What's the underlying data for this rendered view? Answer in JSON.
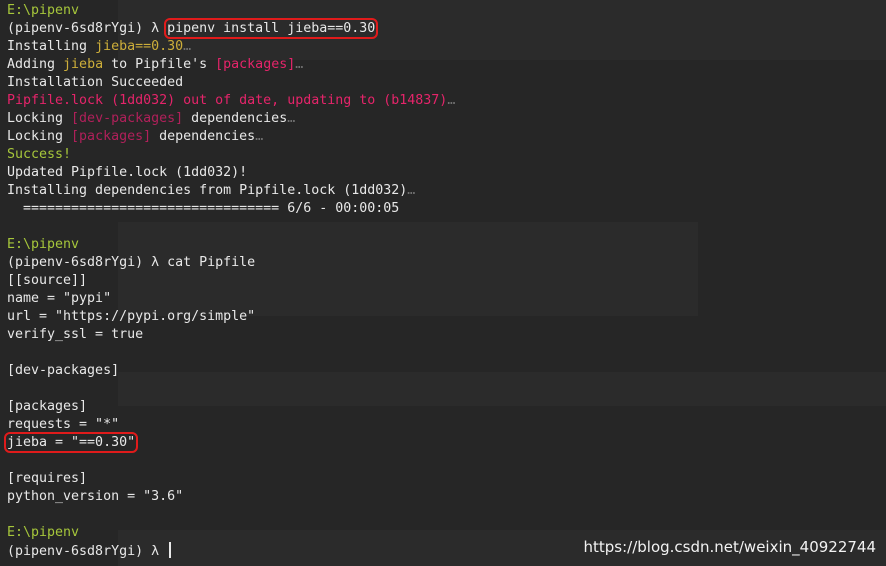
{
  "lines": [
    {
      "segments": [
        {
          "text": "E:\\pipenv",
          "cls": "green"
        }
      ]
    },
    {
      "segments": [
        {
          "text": "(pipenv-6sd8rYgi) λ "
        },
        {
          "text": "pipenv install jieba==0.30",
          "cls": "boxed"
        }
      ]
    },
    {
      "segments": [
        {
          "text": "Installing "
        },
        {
          "text": "jieba==0.30",
          "cls": "yellow"
        },
        {
          "text": "…",
          "cls": "dim"
        }
      ]
    },
    {
      "segments": [
        {
          "text": "Adding "
        },
        {
          "text": "jieba",
          "cls": "yellow"
        },
        {
          "text": " to Pipfile's "
        },
        {
          "text": "[packages]",
          "cls": "magenta"
        },
        {
          "text": "…",
          "cls": "dim"
        }
      ]
    },
    {
      "segments": [
        {
          "text": "Installation Succeeded"
        }
      ]
    },
    {
      "segments": [
        {
          "text": "Pipfile.lock (1dd032) out of date, updating to (b14837)",
          "cls": "magenta"
        },
        {
          "text": "…",
          "cls": "dim"
        }
      ]
    },
    {
      "segments": [
        {
          "text": "Locking "
        },
        {
          "text": "[dev-packages]",
          "cls": "dim-mag"
        },
        {
          "text": " dependencies"
        },
        {
          "text": "…",
          "cls": "dim"
        }
      ]
    },
    {
      "segments": [
        {
          "text": "Locking "
        },
        {
          "text": "[packages]",
          "cls": "dim-mag"
        },
        {
          "text": " dependencies"
        },
        {
          "text": "…",
          "cls": "dim"
        }
      ]
    },
    {
      "segments": [
        {
          "text": "Success!",
          "cls": "green"
        }
      ]
    },
    {
      "segments": [
        {
          "text": "Updated Pipfile.lock (1dd032)!"
        }
      ]
    },
    {
      "segments": [
        {
          "text": "Installing dependencies from Pipfile.lock (1dd032)"
        },
        {
          "text": "…",
          "cls": "dim"
        }
      ]
    },
    {
      "segments": [
        {
          "text": "  ================================ 6/6 - 00:00:05"
        }
      ]
    },
    {
      "segments": [
        {
          "text": ""
        }
      ]
    },
    {
      "segments": [
        {
          "text": "E:\\pipenv",
          "cls": "green"
        }
      ]
    },
    {
      "segments": [
        {
          "text": "(pipenv-6sd8rYgi) λ cat Pipfile"
        }
      ]
    },
    {
      "segments": [
        {
          "text": "[[source]]"
        }
      ]
    },
    {
      "segments": [
        {
          "text": "name = \"pypi\""
        }
      ]
    },
    {
      "segments": [
        {
          "text": "url = \"https://pypi.org/simple\""
        }
      ]
    },
    {
      "segments": [
        {
          "text": "verify_ssl = true"
        }
      ]
    },
    {
      "segments": [
        {
          "text": ""
        }
      ]
    },
    {
      "segments": [
        {
          "text": "[dev-packages]"
        }
      ]
    },
    {
      "segments": [
        {
          "text": ""
        }
      ]
    },
    {
      "segments": [
        {
          "text": "[packages]"
        }
      ]
    },
    {
      "segments": [
        {
          "text": "requests = \"*\""
        }
      ]
    },
    {
      "segments": [
        {
          "text": "jieba = \"==0.30\"",
          "cls": "boxed"
        }
      ]
    },
    {
      "segments": [
        {
          "text": ""
        }
      ]
    },
    {
      "segments": [
        {
          "text": "[requires]"
        }
      ]
    },
    {
      "segments": [
        {
          "text": "python_version = \"3.6\""
        }
      ]
    },
    {
      "segments": [
        {
          "text": ""
        }
      ]
    },
    {
      "segments": [
        {
          "text": "E:\\pipenv",
          "cls": "green"
        }
      ]
    },
    {
      "segments": [
        {
          "text": "(pipenv-6sd8rYgi) λ "
        }
      ],
      "cursor": true
    }
  ],
  "watermark": "https://blog.csdn.net/weixin_40922744",
  "colors": {
    "background": "#262626",
    "text": "#e8e8e8",
    "green": "#a6c63b",
    "yellow": "#cdae3a",
    "magenta": "#e5246a",
    "highlight_box": "#e01b1b"
  }
}
